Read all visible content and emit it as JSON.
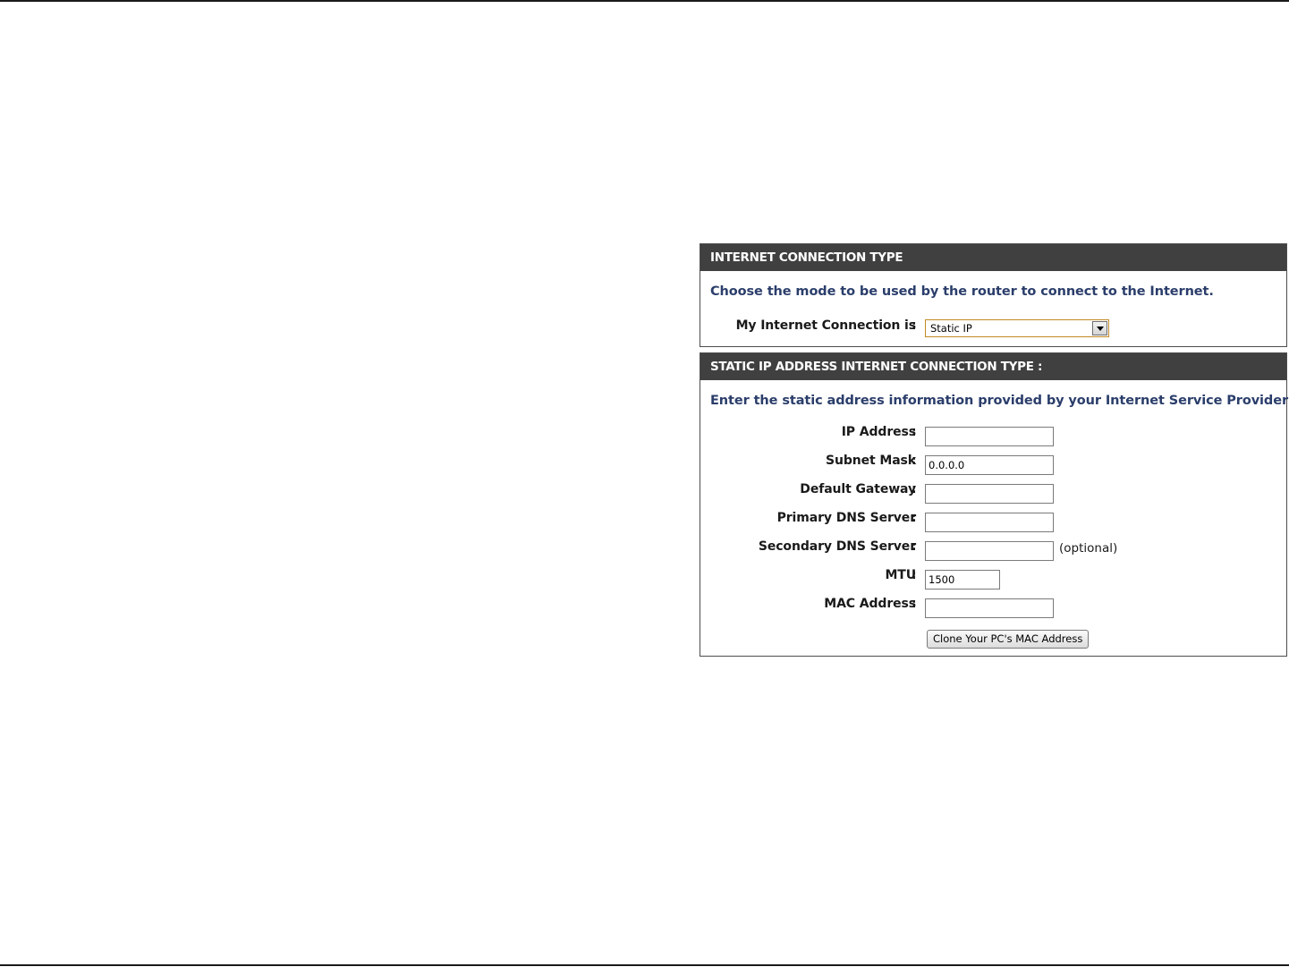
{
  "connection_type_panel": {
    "header": "INTERNET CONNECTION TYPE",
    "description": "Choose the mode to be used by the router to connect to the Internet.",
    "connection_label": "My Internet Connection is",
    "colon": ":",
    "selected_mode": "Static IP"
  },
  "static_ip_panel": {
    "header": "STATIC IP ADDRESS INTERNET CONNECTION TYPE :",
    "description": "Enter the static address information provided by your Internet Service Provider (ISP).",
    "colon": ":",
    "fields": [
      {
        "label": "IP Address",
        "value": ""
      },
      {
        "label": "Subnet Mask",
        "value": "0.0.0.0"
      },
      {
        "label": "Default Gateway",
        "value": ""
      },
      {
        "label": "Primary DNS Server",
        "value": ""
      },
      {
        "label": "Secondary DNS Server",
        "value": "",
        "note": "(optional)"
      },
      {
        "label": "MTU",
        "value": "1500"
      },
      {
        "label": "MAC Address",
        "value": ""
      }
    ],
    "clone_button_label": "Clone Your PC's MAC Address"
  },
  "colors": {
    "header_bg": "#404040",
    "header_text": "#ffffff",
    "description_text": "#2b3e6b",
    "select_border": "#c08a24"
  }
}
